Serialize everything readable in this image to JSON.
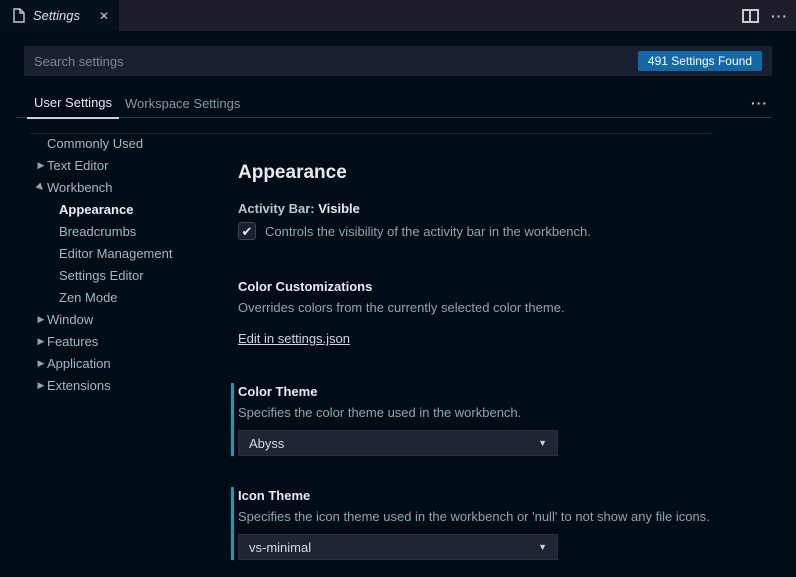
{
  "tab_bar": {
    "tab_title": "Settings",
    "close_glyph": "✕",
    "more_glyph": "···"
  },
  "search": {
    "placeholder": "Search settings",
    "badge": "491 Settings Found"
  },
  "scope": {
    "tabs": [
      {
        "label": "User Settings",
        "active": true
      },
      {
        "label": "Workspace Settings",
        "active": false
      }
    ],
    "more_glyph": "···"
  },
  "tree": {
    "items": [
      {
        "label": "Commonly Used",
        "level": 0,
        "twistie": "none",
        "active": false
      },
      {
        "label": "Text Editor",
        "level": 0,
        "twistie": "collapsed",
        "active": false
      },
      {
        "label": "Workbench",
        "level": 0,
        "twistie": "expanded",
        "active": false
      },
      {
        "label": "Appearance",
        "level": 1,
        "twistie": "none",
        "active": true
      },
      {
        "label": "Breadcrumbs",
        "level": 1,
        "twistie": "none",
        "active": false
      },
      {
        "label": "Editor Management",
        "level": 1,
        "twistie": "none",
        "active": false
      },
      {
        "label": "Settings Editor",
        "level": 1,
        "twistie": "none",
        "active": false
      },
      {
        "label": "Zen Mode",
        "level": 1,
        "twistie": "none",
        "active": false
      },
      {
        "label": "Window",
        "level": 0,
        "twistie": "collapsed",
        "active": false
      },
      {
        "label": "Features",
        "level": 0,
        "twistie": "collapsed",
        "active": false
      },
      {
        "label": "Application",
        "level": 0,
        "twistie": "collapsed",
        "active": false
      },
      {
        "label": "Extensions",
        "level": 0,
        "twistie": "collapsed",
        "active": false
      }
    ],
    "collapsed_glyph": "▶",
    "expanded_glyph": "▶"
  },
  "content": {
    "section_title": "Appearance",
    "activity_bar": {
      "label_prefix": "Activity Bar: ",
      "label_value": "Visible",
      "checked": true,
      "check_glyph": "✔",
      "description": "Controls the visibility of the activity bar in the workbench."
    },
    "color_customizations": {
      "title": "Color Customizations",
      "description": "Overrides colors from the currently selected color theme.",
      "link": "Edit in settings.json"
    },
    "color_theme": {
      "title": "Color Theme",
      "description": "Specifies the color theme used in the workbench.",
      "value": "Abyss",
      "modified": true
    },
    "icon_theme": {
      "title": "Icon Theme",
      "description": "Specifies the icon theme used in the workbench or 'null' to not show any file icons.",
      "value": "vs-minimal",
      "modified": true
    },
    "dropdown_caret": "▼"
  },
  "colors": {
    "background": "#020c16",
    "tab_strip": "#1e1d2a",
    "input_background": "#19202f",
    "badge_background": "#1568a8",
    "modified_indicator": "#189ab8",
    "active_underline": "#d7dade"
  }
}
